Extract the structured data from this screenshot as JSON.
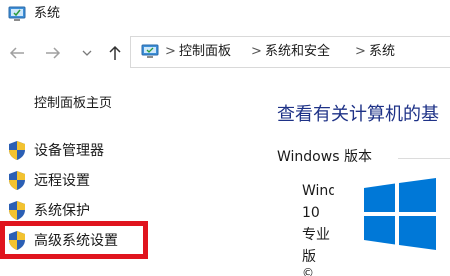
{
  "window": {
    "title": "系统",
    "title_icon": "computer-icon"
  },
  "nav": {
    "back_icon": "arrow-left-icon",
    "forward_icon": "arrow-right-icon",
    "dropdown_icon": "chevron-down-icon",
    "up_icon": "arrow-up-icon",
    "address": {
      "icon": "computer-icon",
      "crumbs": [
        "控制面板",
        "系统和安全",
        "系统"
      ],
      "separator": ">"
    }
  },
  "sidebar": {
    "home_label": "控制面板主页",
    "items": [
      {
        "label": "设备管理器",
        "icon": "shield-icon"
      },
      {
        "label": "远程设置",
        "icon": "shield-icon"
      },
      {
        "label": "系统保护",
        "icon": "shield-icon"
      },
      {
        "label": "高级系统设置",
        "icon": "shield-icon",
        "highlighted": true
      }
    ]
  },
  "main": {
    "heading": "查看有关计算机的基",
    "section_title": "Windows 版本",
    "edition_lines": [
      "Wind",
      "10",
      "专业",
      "版"
    ],
    "copyright": "©"
  },
  "colors": {
    "heading": "#1e3287",
    "highlight_border": "#e0141e",
    "windows_logo": "#0078d7",
    "shield_blue": "#2b5fb4",
    "shield_yellow": "#f2c230"
  }
}
